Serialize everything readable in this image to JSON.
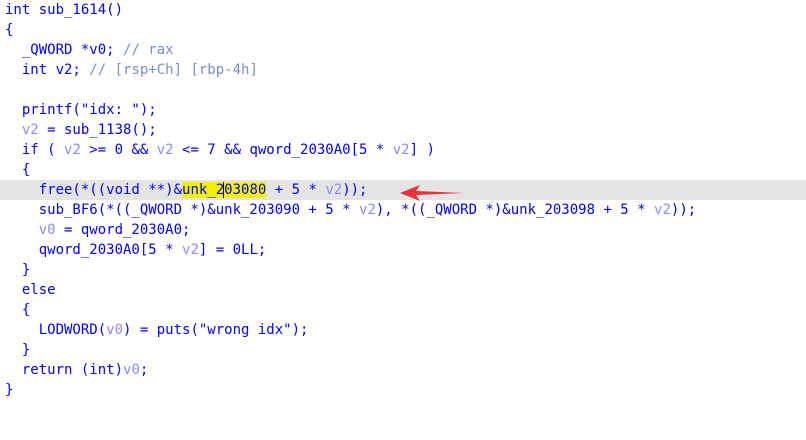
{
  "code": {
    "lines": [
      [
        "int sub_1614()"
      ],
      [
        "{"
      ],
      [
        "  _QWORD *v0; ",
        "// rax"
      ],
      [
        "  int v2; ",
        "// [rsp+Ch] [rbp-4h]"
      ],
      [
        ""
      ],
      [
        "  printf(\"idx: \");"
      ],
      [
        "  ",
        "v2",
        " = sub_1138();"
      ],
      [
        "  if ( ",
        "v2",
        " >= 0 && ",
        "v2",
        " <= 7 && qword_2030A0[5 * ",
        "v2",
        "] )"
      ],
      [
        "  {"
      ],
      [
        "    free(*((void **)&",
        "unk_2",
        "03080",
        " + 5 * ",
        "v2",
        "));"
      ],
      [
        "    sub_BF6(*((_QWORD *)&unk_203090 + 5 * ",
        "v2",
        "), *((_QWORD *)&unk_203098 + 5 * ",
        "v2",
        "));"
      ],
      [
        "    ",
        "v0",
        " = qword_2030A0;"
      ],
      [
        "    qword_2030A0[5 * ",
        "v2",
        "] = 0LL;"
      ],
      [
        "  }"
      ],
      [
        "  else"
      ],
      [
        "  {"
      ],
      [
        "    LODWORD(",
        "v0",
        ") = puts(\"wrong idx\");"
      ],
      [
        "  }"
      ],
      [
        "  return (int)",
        "v0",
        ";"
      ],
      [
        "}"
      ]
    ]
  },
  "colors": {
    "text": "#0000ff",
    "dim": "#8a8aff",
    "highlight_line": "#e4e4e4",
    "search_highlight": "#f2f200",
    "arrow": "#e8303a"
  },
  "annotation": {
    "icon": "red-arrow-icon"
  }
}
